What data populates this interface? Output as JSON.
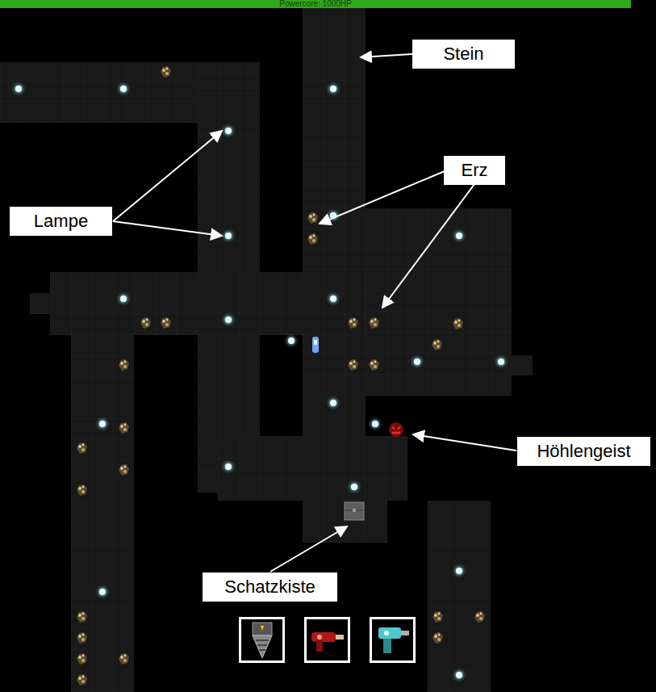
{
  "hud": {
    "powercore": "Powercore: 1000HP",
    "level": 0.962
  },
  "annotations": [
    {
      "text": "Stein"
    },
    {
      "text": "Erz"
    },
    {
      "text": "Lampe"
    },
    {
      "text": "Höhlengeist"
    },
    {
      "text": "Schatzkiste"
    }
  ],
  "tools": [
    {
      "kind": "drill"
    },
    {
      "kind": "raygun"
    },
    {
      "kind": "drillgun"
    }
  ]
}
